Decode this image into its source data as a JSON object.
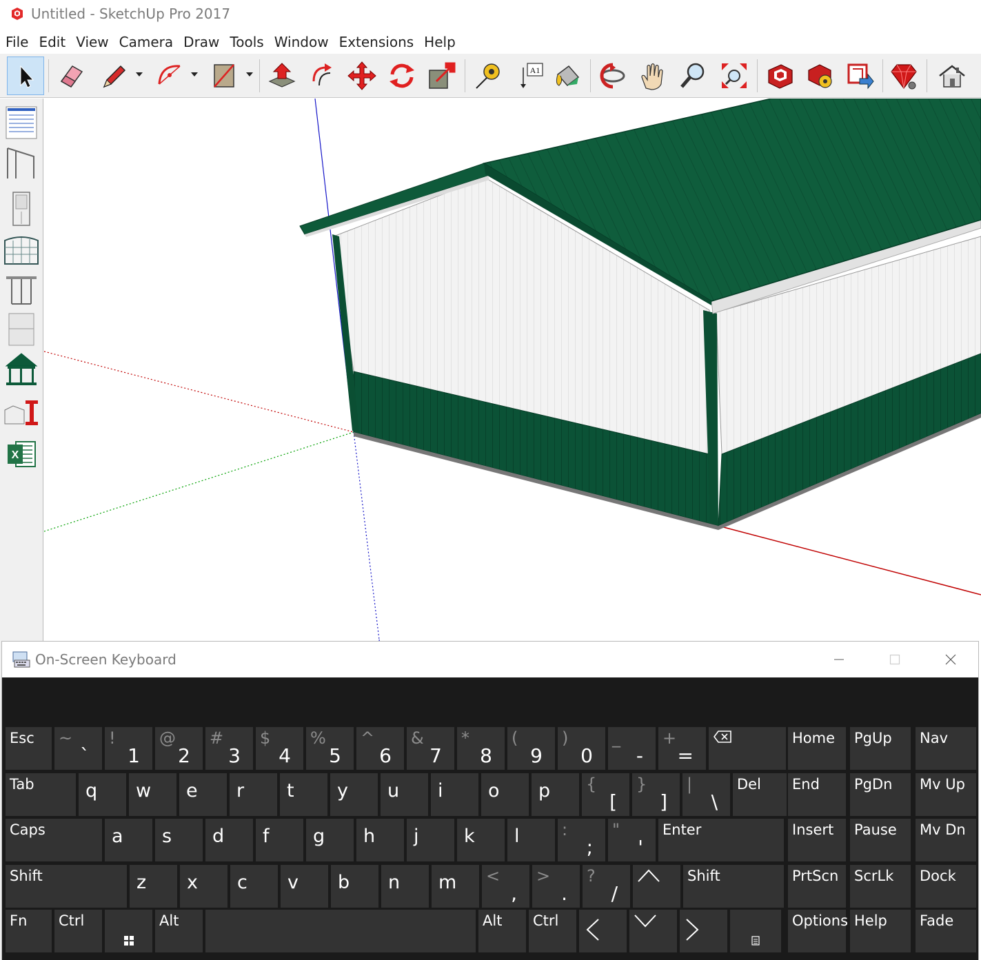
{
  "window": {
    "title": "Untitled - SketchUp Pro 2017",
    "icon": "sketchup-logo-icon"
  },
  "menu": [
    "File",
    "Edit",
    "View",
    "Camera",
    "Draw",
    "Tools",
    "Window",
    "Extensions",
    "Help"
  ],
  "toolbar": {
    "tools": [
      {
        "name": "select-tool-button",
        "icon": "arrow-cursor-icon",
        "active": true
      },
      {
        "name": "eraser-tool-button",
        "icon": "eraser-icon"
      },
      {
        "name": "line-tool-button",
        "icon": "pencil-icon"
      },
      {
        "name": "arc-tool-button",
        "icon": "arc-icon"
      },
      {
        "name": "rectangle-tool-button",
        "icon": "rectangle-icon"
      },
      {
        "name": "push-pull-tool-button",
        "icon": "push-pull-icon"
      },
      {
        "name": "offset-tool-button",
        "icon": "offset-icon"
      },
      {
        "name": "move-tool-button",
        "icon": "move-icon"
      },
      {
        "name": "rotate-tool-button",
        "icon": "rotate-icon"
      },
      {
        "name": "scale-tool-button",
        "icon": "scale-icon"
      },
      {
        "name": "tape-measure-tool-button",
        "icon": "tape-measure-icon"
      },
      {
        "name": "text-tool-button",
        "icon": "text-label-icon"
      },
      {
        "name": "paint-bucket-tool-button",
        "icon": "paint-bucket-icon"
      },
      {
        "name": "orbit-tool-button",
        "icon": "orbit-icon"
      },
      {
        "name": "pan-tool-button",
        "icon": "hand-icon"
      },
      {
        "name": "zoom-tool-button",
        "icon": "magnifier-icon"
      },
      {
        "name": "zoom-extents-tool-button",
        "icon": "zoom-extents-icon"
      },
      {
        "name": "warehouse-button",
        "icon": "3d-warehouse-icon"
      },
      {
        "name": "extension-warehouse-button",
        "icon": "extension-warehouse-icon"
      },
      {
        "name": "share-model-button",
        "icon": "share-model-icon"
      },
      {
        "name": "ruby-console-button",
        "icon": "ruby-gem-icon"
      },
      {
        "name": "home-button",
        "icon": "house-icon"
      }
    ],
    "text_tool_label": "A1"
  },
  "left_strip": {
    "tools": [
      "form-sheet-icon",
      "lean-to-icon",
      "door-icon",
      "garage-door-icon",
      "window-frame-icon",
      "panel-icon",
      "gazebo-icon",
      "steel-beam-icon",
      "excel-export-icon"
    ]
  },
  "colors": {
    "roof_green": "#0e5a3a",
    "wainscot_green": "#0b4f33",
    "siding_white": "#f2f2f2",
    "axis_red": "#c00000",
    "axis_green": "#00a000",
    "axis_blue": "#0000c0",
    "keyboard_bg": "#1a1a1a",
    "key_bg": "#333333"
  },
  "osk": {
    "title": "On-Screen Keyboard",
    "icon": "keyboard-icon",
    "rows": [
      [
        {
          "type": "label",
          "label": "Esc"
        },
        {
          "type": "dual",
          "shift": "~",
          "base": "`"
        },
        {
          "type": "dual",
          "shift": "!",
          "base": "1"
        },
        {
          "type": "dual",
          "shift": "@",
          "base": "2"
        },
        {
          "type": "dual",
          "shift": "#",
          "base": "3"
        },
        {
          "type": "dual",
          "shift": "$",
          "base": "4"
        },
        {
          "type": "dual",
          "shift": "%",
          "base": "5"
        },
        {
          "type": "dual",
          "shift": "^",
          "base": "6"
        },
        {
          "type": "dual",
          "shift": "&",
          "base": "7"
        },
        {
          "type": "dual",
          "shift": "*",
          "base": "8"
        },
        {
          "type": "dual",
          "shift": "(",
          "base": "9"
        },
        {
          "type": "dual",
          "shift": ")",
          "base": "0"
        },
        {
          "type": "dual",
          "shift": "_",
          "base": "-"
        },
        {
          "type": "dual",
          "shift": "+",
          "base": "="
        },
        {
          "type": "icon",
          "icon": "backspace-icon"
        }
      ],
      [
        {
          "type": "label",
          "label": "Tab"
        },
        {
          "type": "char",
          "label": "q"
        },
        {
          "type": "char",
          "label": "w"
        },
        {
          "type": "char",
          "label": "e"
        },
        {
          "type": "char",
          "label": "r"
        },
        {
          "type": "char",
          "label": "t"
        },
        {
          "type": "char",
          "label": "y"
        },
        {
          "type": "char",
          "label": "u"
        },
        {
          "type": "char",
          "label": "i"
        },
        {
          "type": "char",
          "label": "o"
        },
        {
          "type": "char",
          "label": "p"
        },
        {
          "type": "dual",
          "shift": "{",
          "base": "["
        },
        {
          "type": "dual",
          "shift": "}",
          "base": "]"
        },
        {
          "type": "dual",
          "shift": "|",
          "base": "\\"
        },
        {
          "type": "label",
          "label": "Del"
        }
      ],
      [
        {
          "type": "label",
          "label": "Caps"
        },
        {
          "type": "char",
          "label": "a"
        },
        {
          "type": "char",
          "label": "s"
        },
        {
          "type": "char",
          "label": "d"
        },
        {
          "type": "char",
          "label": "f"
        },
        {
          "type": "char",
          "label": "g"
        },
        {
          "type": "char",
          "label": "h"
        },
        {
          "type": "char",
          "label": "j"
        },
        {
          "type": "char",
          "label": "k"
        },
        {
          "type": "char",
          "label": "l"
        },
        {
          "type": "dual",
          "shift": ":",
          "base": ";"
        },
        {
          "type": "dual",
          "shift": "\"",
          "base": "'"
        },
        {
          "type": "label",
          "label": "Enter"
        }
      ],
      [
        {
          "type": "label",
          "label": "Shift"
        },
        {
          "type": "char",
          "label": "z"
        },
        {
          "type": "char",
          "label": "x"
        },
        {
          "type": "char",
          "label": "c"
        },
        {
          "type": "char",
          "label": "v"
        },
        {
          "type": "char",
          "label": "b"
        },
        {
          "type": "char",
          "label": "n"
        },
        {
          "type": "char",
          "label": "m"
        },
        {
          "type": "dual",
          "shift": "<",
          "base": ","
        },
        {
          "type": "dual",
          "shift": ">",
          "base": "."
        },
        {
          "type": "dual",
          "shift": "?",
          "base": "/"
        },
        {
          "type": "icon",
          "icon": "arrow-up-icon"
        },
        {
          "type": "label",
          "label": "Shift"
        }
      ],
      [
        {
          "type": "label",
          "label": "Fn"
        },
        {
          "type": "label",
          "label": "Ctrl"
        },
        {
          "type": "icon",
          "icon": "windows-logo-icon"
        },
        {
          "type": "label",
          "label": "Alt"
        },
        {
          "type": "label",
          "label": ""
        },
        {
          "type": "label",
          "label": "Alt"
        },
        {
          "type": "label",
          "label": "Ctrl"
        },
        {
          "type": "icon",
          "icon": "arrow-left-icon"
        },
        {
          "type": "icon",
          "icon": "arrow-down-icon"
        },
        {
          "type": "icon",
          "icon": "arrow-right-icon"
        },
        {
          "type": "icon",
          "icon": "context-menu-icon"
        }
      ]
    ],
    "nav_keys": [
      [
        "Home",
        "PgUp",
        "Nav"
      ],
      [
        "End",
        "PgDn",
        "Mv Up"
      ],
      [
        "Insert",
        "Pause",
        "Mv Dn"
      ],
      [
        "PrtScn",
        "ScrLk",
        "Dock"
      ],
      [
        "Options",
        "Help",
        "Fade"
      ]
    ]
  }
}
